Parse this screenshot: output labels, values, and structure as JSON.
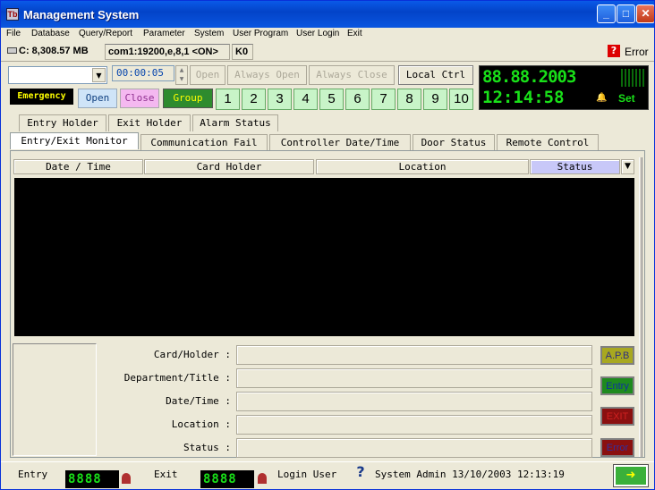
{
  "window": {
    "title": "Management System",
    "app_icon": "Tb"
  },
  "menu": [
    "File",
    "Database",
    "Query/Report",
    "Parameter",
    "System",
    "User Program",
    "User Login",
    "Exit"
  ],
  "status_top": {
    "disk": "C: 8,308.57 MB",
    "port": "com1:19200,e,8,1 <ON>",
    "k": "K0",
    "error": "Error"
  },
  "toolbar": {
    "timer": "00:00:05",
    "open": "Open",
    "always_open": "Always Open",
    "always_close": "Always Close",
    "local_ctrl": "Local Ctrl",
    "led_date": "88.88.2003",
    "led_time": "12:14:58",
    "set": "Set"
  },
  "controls": {
    "emergency": "Emergency",
    "open": "Open",
    "close": "Close",
    "group": "Group",
    "doors": [
      "1",
      "2",
      "3",
      "4",
      "5",
      "6",
      "7",
      "8",
      "9",
      "10"
    ]
  },
  "tabs_row1": [
    "Entry Holder",
    "Exit Holder",
    "Alarm Status"
  ],
  "tabs_row2": [
    "Entry/Exit Monitor",
    "Communication Fail",
    "Controller Date/Time",
    "Door Status",
    "Remote Control"
  ],
  "grid": {
    "columns": [
      "Date / Time",
      "Card Holder",
      "Location",
      "Status"
    ]
  },
  "details": {
    "labels": [
      "Card/Holder :",
      "Department/Title :",
      "Date/Time :",
      "Location :",
      "Status :"
    ],
    "buttons": {
      "apb": "A.P.B",
      "entry": "Entry",
      "exit": "EXIT",
      "error": "Error"
    }
  },
  "bottom": {
    "entry": "Entry",
    "entry_count": "8888",
    "exit": "Exit",
    "exit_count": "8888",
    "login_user": "Login User",
    "user_info": "System Admin 13/10/2003 12:13:19"
  },
  "colors": {
    "led": "#19e019",
    "accent": "#0a56e0"
  }
}
